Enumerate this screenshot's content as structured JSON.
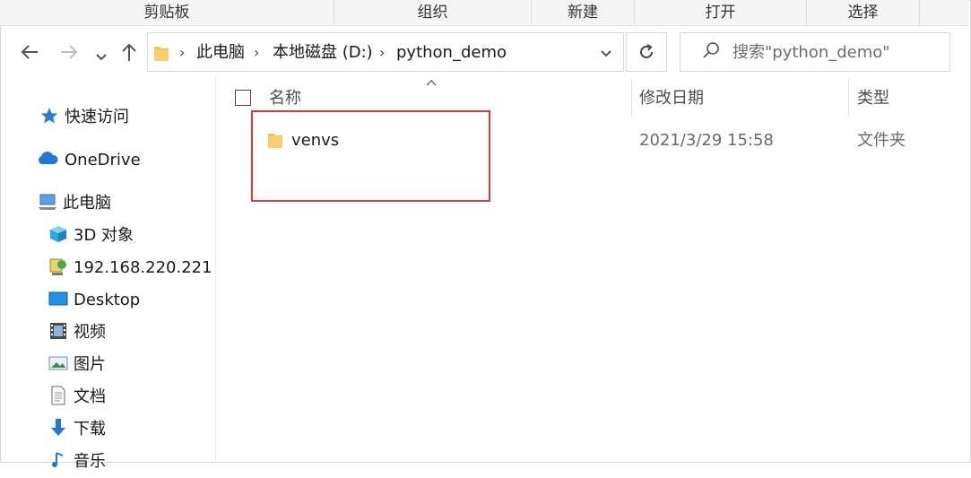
{
  "ribbon": {
    "groups": [
      "剪贴板",
      "组织",
      "新建",
      "打开",
      "选择"
    ]
  },
  "nav": {
    "back_icon": "arrow-left-icon",
    "forward_icon": "arrow-right-icon",
    "recent_icon": "chevron-down-icon",
    "up_icon": "arrow-up-icon"
  },
  "address": {
    "folder_icon": "folder-icon",
    "segments": [
      "此电脑",
      "本地磁盘 (D:)",
      "python_demo"
    ],
    "separator": "›",
    "dropdown_icon": "chevron-down-icon"
  },
  "refresh_icon": "refresh-icon",
  "search": {
    "placeholder": "搜索\"python_demo\"",
    "icon": "search-icon"
  },
  "sidebar": {
    "items": [
      {
        "label": "快速访问",
        "icon": "star-icon"
      },
      {
        "label": "OneDrive",
        "icon": "cloud-icon"
      },
      {
        "label": "此电脑",
        "icon": "computer-icon"
      },
      {
        "label": "3D 对象",
        "icon": "cube-icon"
      },
      {
        "label": "192.168.220.221",
        "icon": "network-drive-icon"
      },
      {
        "label": "Desktop",
        "icon": "desktop-icon"
      },
      {
        "label": "视频",
        "icon": "video-icon"
      },
      {
        "label": "图片",
        "icon": "picture-icon"
      },
      {
        "label": "文档",
        "icon": "document-icon"
      },
      {
        "label": "下载",
        "icon": "download-icon"
      },
      {
        "label": "音乐",
        "icon": "music-icon"
      }
    ]
  },
  "columns": {
    "name": "名称",
    "modified": "修改日期",
    "type": "类型"
  },
  "files": [
    {
      "name": "venvs",
      "modified": "2021/3/29 15:58",
      "type": "文件夹",
      "icon": "folder-icon"
    }
  ],
  "colors": {
    "highlight_border": "#e0393e",
    "folder": "#f2c14e",
    "accent": "#1e78d4"
  }
}
